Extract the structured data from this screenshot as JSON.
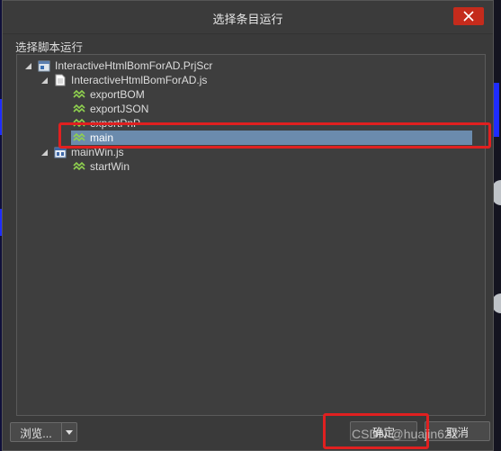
{
  "dialog": {
    "title": "选择条目运行",
    "section_label": "选择脚本运行"
  },
  "tree": {
    "project": {
      "label": "InteractiveHtmlBomForAD.PrjScr",
      "icon": "project-icon"
    },
    "script1": {
      "label": "InteractiveHtmlBomForAD.js",
      "icon": "script-file-icon"
    },
    "functions1": [
      {
        "label": "exportBOM",
        "icon": "function-icon"
      },
      {
        "label": "exportJSON",
        "icon": "function-icon"
      },
      {
        "label": "exportPnP",
        "icon": "function-icon"
      },
      {
        "label": "main",
        "icon": "function-icon",
        "selected": true
      }
    ],
    "script2": {
      "label": "mainWin.js",
      "icon": "form-script-icon"
    },
    "functions2": [
      {
        "label": "startWin",
        "icon": "function-icon"
      }
    ]
  },
  "buttons": {
    "browse": "浏览...",
    "ok": "确定",
    "cancel": "取消"
  },
  "watermark": "CSDN @huajin622",
  "colors": {
    "selection": "#6b8bad",
    "highlight": "#e02020",
    "close": "#c42b1c",
    "function_icon": "#8fd14f"
  }
}
